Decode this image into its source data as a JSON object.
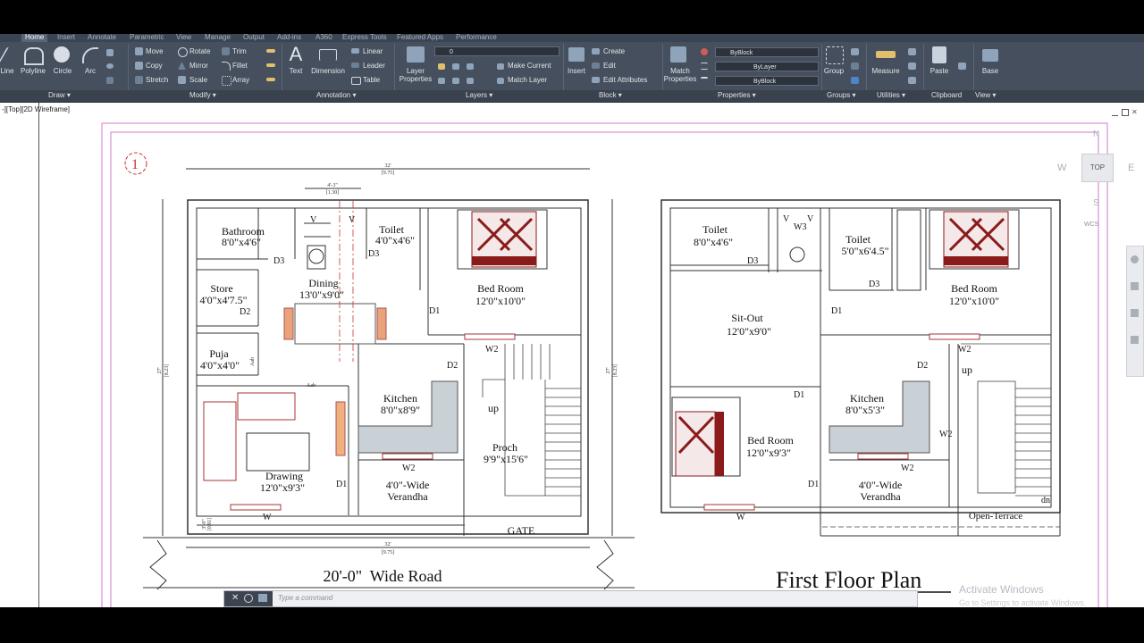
{
  "tabs": [
    "Home",
    "Insert",
    "Annotate",
    "Parametric",
    "View",
    "Manage",
    "Output",
    "Add-ins",
    "A360",
    "Express Tools",
    "Featured Apps",
    "Performance"
  ],
  "ribbon": {
    "draw": {
      "line": "Line",
      "polyline": "Polyline",
      "circle": "Circle",
      "arc": "Arc"
    },
    "modify": {
      "move": "Move",
      "rotate": "Rotate",
      "trim": "Trim",
      "copy": "Copy",
      "mirror": "Mirror",
      "fillet": "Fillet",
      "stretch": "Stretch",
      "scale": "Scale",
      "array": "Array"
    },
    "annotation": {
      "text": "Text",
      "dimension": "Dimension",
      "linear": "Linear",
      "leader": "Leader",
      "table": "Table"
    },
    "layers": {
      "layer_properties": "Layer Properties",
      "layer_value": "0",
      "make_current": "Make Current",
      "match_layer": "Match Layer"
    },
    "block": {
      "insert": "Insert",
      "create": "Create",
      "edit": "Edit",
      "edit_attributes": "Edit Attributes"
    },
    "properties": {
      "match_properties": "Match Properties",
      "color": "ByBlock",
      "linetype": "ByLayer",
      "lineweight": "ByBlock"
    },
    "groups": {
      "group": "Group"
    },
    "utilities": {
      "measure": "Measure"
    },
    "clipboard": {
      "paste": "Paste"
    },
    "view": {
      "base": "Base"
    }
  },
  "panels": {
    "draw": "Draw ▾",
    "modify": "Modify ▾",
    "annotation": "Annotation ▾",
    "layers": "Layers ▾",
    "block": "Block ▾",
    "properties": "Properties ▾",
    "groups": "Groups ▾",
    "utilities": "Utilities ▾",
    "clipboard": "Clipboard",
    "view": "View ▾"
  },
  "viewport_label": "-][Top][2D Wireframe]",
  "viewcube": {
    "n": "N",
    "s": "S",
    "e": "E",
    "w": "W",
    "top": "TOP",
    "wcs": "WCS"
  },
  "command": {
    "placeholder": "Type a command"
  },
  "watermark": {
    "title": "Activate Windows",
    "subtitle": "Go to Settings to activate Windows."
  },
  "drawing": {
    "marker": "1",
    "dims": {
      "top_width": "32'",
      "top_width_m": "[9.75]",
      "left_height": "27'",
      "left_height_m": "[8.23]",
      "right_height": "27'",
      "right_height_m": "[8.23]",
      "bottom_width": "32'",
      "bottom_width_m": "[9.75]",
      "opening": "4'-3\"",
      "opening_m": "[1.30]",
      "small": "4'-3\"",
      "bottom_small": "3'-0\"",
      "bottom_small_m": "[0.91]"
    },
    "ground": {
      "bathroom": {
        "name": "Bathroom",
        "size": "8'0\"x4'6\""
      },
      "toilet": {
        "name": "Toilet",
        "size": "4'0\"x4'6\""
      },
      "bedroom": {
        "name": "Bed Room",
        "size": "12'0\"x10'0\""
      },
      "store": {
        "name": "Store",
        "size": "4'0\"x4'7.5\""
      },
      "dining": {
        "name": "Dining",
        "size": "13'0\"x9'0\""
      },
      "puja": {
        "name": "Puja",
        "size": "4'0\"x4'0\""
      },
      "kitchen": {
        "name": "Kitchen",
        "size": "8'0\"x8'9\""
      },
      "drawing": {
        "name": "Drawing",
        "size": "12'0\"x9'3\""
      },
      "verandha": {
        "name": "4'0\"-Wide",
        "name2": "Verandha"
      },
      "proch": {
        "name": "Proch",
        "size": "9'9\"x15'6\""
      },
      "gate": "GATE",
      "up": "up",
      "labels": {
        "d1": "D1",
        "d2": "D2",
        "d3": "D3",
        "w": "W",
        "w2": "W2",
        "v": "V",
        "aab": "Aab"
      }
    },
    "road": "20'-0\"  Wide Road",
    "first": {
      "toilet1": {
        "name": "Toilet",
        "size": "8'0\"x4'6\""
      },
      "toilet2": {
        "name": "Toilet",
        "size": "5'0\"x6'4.5\""
      },
      "bedroom1": {
        "name": "Bed Room",
        "size": "12'0\"x10'0\""
      },
      "sitout": {
        "name": "Sit-Out",
        "size": "12'0\"x9'0\""
      },
      "kitchen": {
        "name": "Kitchen",
        "size": "8'0\"x5'3\""
      },
      "bedroom2": {
        "name": "Bed Room",
        "size": "12'0\"x9'3\""
      },
      "verandha": {
        "name": "4'0\"-Wide",
        "name2": "Verandha"
      },
      "terrace": "Open-Terrace",
      "up": "up",
      "dn": "dn",
      "labels": {
        "d1": "D1",
        "d2": "D2",
        "d3": "D3",
        "w": "W",
        "w2": "W2",
        "w3": "W3",
        "v": "V"
      }
    },
    "first_title": "First Floor Plan"
  }
}
